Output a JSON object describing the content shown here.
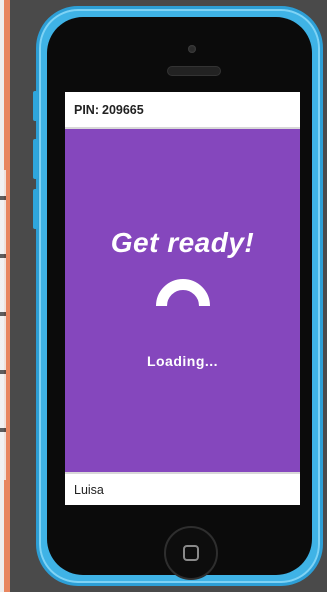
{
  "game": {
    "pin_label": "PIN:",
    "pin_value": "209665",
    "title": "Get ready!",
    "status": "Loading...",
    "player_name": "Luisa"
  },
  "colors": {
    "stage_background": "#8547bd",
    "phone_body": "#3fb3e6",
    "text_light": "#ffffff"
  },
  "icons": {
    "spinner": "loading-spinner-icon",
    "home": "home-button-icon"
  }
}
